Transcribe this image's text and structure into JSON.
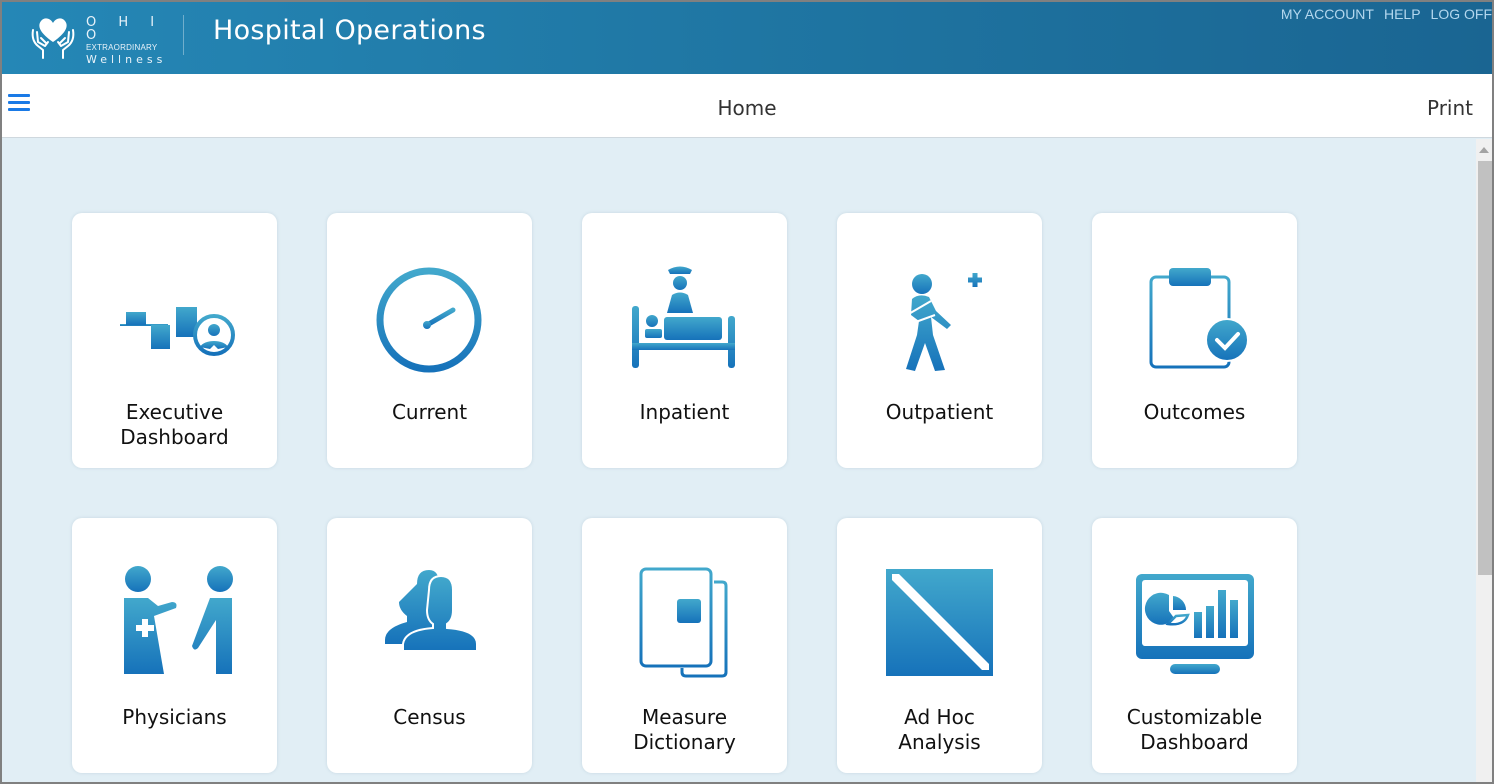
{
  "header": {
    "logo": {
      "line1": "O H I O",
      "line2": "EXTRAORDINARY",
      "line3": "Wellness",
      "icon": "heart-hands-icon"
    },
    "app_title": "Hospital Operations",
    "links": [
      {
        "label": "MY ACCOUNT"
      },
      {
        "label": "HELP"
      },
      {
        "label": "LOG OFF"
      }
    ]
  },
  "toolbar": {
    "menu_icon": "hamburger-menu-icon",
    "page_title": "Home",
    "print_label": "Print"
  },
  "tiles": [
    {
      "label": "Executive\nDashboard",
      "icon": "executive-dashboard-icon"
    },
    {
      "label": "Current",
      "icon": "clock-icon"
    },
    {
      "label": "Inpatient",
      "icon": "hospital-bed-icon"
    },
    {
      "label": "Outpatient",
      "icon": "injured-walking-person-icon"
    },
    {
      "label": "Outcomes",
      "icon": "clipboard-check-icon"
    },
    {
      "label": "Physicians",
      "icon": "physician-patient-icon"
    },
    {
      "label": "Census",
      "icon": "people-icon"
    },
    {
      "label": "Measure\nDictionary",
      "icon": "documents-icon"
    },
    {
      "label": "Ad Hoc\nAnalysis",
      "icon": "ad-hoc-analysis-icon"
    },
    {
      "label": "Customizable\nDashboard",
      "icon": "monitor-chart-icon"
    }
  ],
  "colors": {
    "header_start": "#2587b6",
    "header_end": "#1a6592",
    "accent": "#1a7ae6",
    "icon_light": "#42a8cc",
    "icon_dark": "#1672ba",
    "content_bg": "#e1eef5"
  }
}
